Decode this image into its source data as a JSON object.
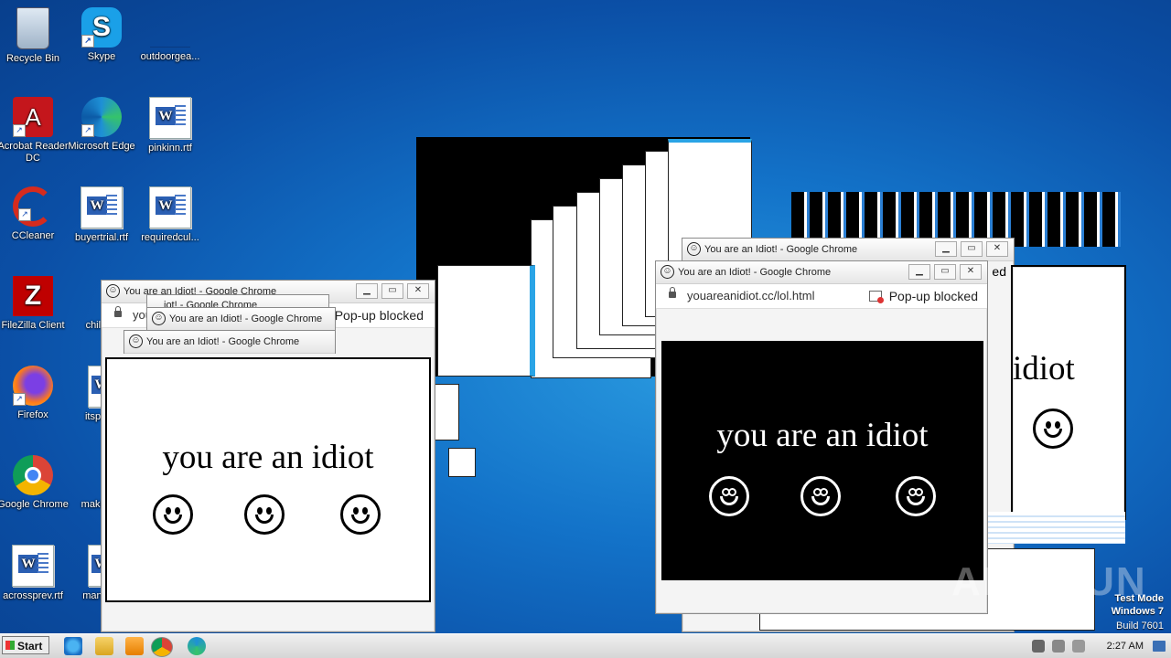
{
  "desktop": {
    "icons": [
      {
        "label": "Recycle Bin"
      },
      {
        "label": "Skype"
      },
      {
        "label": "outdoorgea..."
      },
      {
        "label": "Acrobat Reader DC"
      },
      {
        "label": "Microsoft Edge"
      },
      {
        "label": "pinkinn.rtf"
      },
      {
        "label": "CCleaner"
      },
      {
        "label": "buyertrial.rtf"
      },
      {
        "label": "requiredcul..."
      },
      {
        "label": "FileZilla Client"
      },
      {
        "label": "childr..."
      },
      {
        "label": "Firefox"
      },
      {
        "label": "itspre..."
      },
      {
        "label": "Google Chrome"
      },
      {
        "label": "making..."
      },
      {
        "label": "acrossprev.rtf"
      },
      {
        "label": "manyc..."
      }
    ]
  },
  "windows": {
    "left_main_title": "You are an Idiot! - Google Chrome",
    "left_stack_title_1": "iot! - Google Chrome",
    "left_stack_title_2": "You are an Idiot! - Google Chrome",
    "left_stack_title_3": "You are an Idiot! - Google Chrome",
    "left_addr_partial": "you a",
    "left_popup": "Pop-up blocked",
    "right_back_title": "You are an Idiot! - Google Chrome",
    "right_back_partial_text": "ed",
    "right_main_title": "You are an Idiot! - Google Chrome",
    "right_main_url": "youareanidiot.cc/lol.html",
    "right_main_popup": "Pop-up blocked",
    "idiot_text": "you are an idiot",
    "right_fragment_text": "idiot"
  },
  "taskbar": {
    "start_label": "Start",
    "clock": "2:27 AM"
  },
  "watermark": {
    "line1": "Test Mode",
    "line2": "Windows 7",
    "line3": "Build 7601",
    "anyrun": "ANY RUN"
  }
}
